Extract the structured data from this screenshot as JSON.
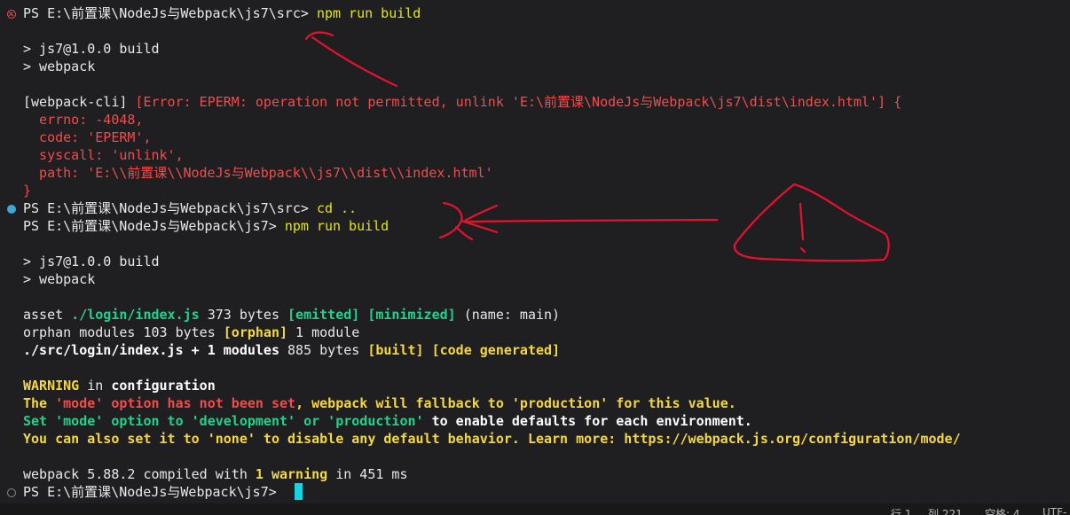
{
  "terminal": {
    "cmd1": {
      "prompt": "PS E:\\前置课\\NodeJs与Webpack\\js7\\src> ",
      "command": "npm run build"
    },
    "build1": {
      "script": "> js7@1.0.0 build",
      "webpack": "> webpack"
    },
    "error": {
      "prefix": "[webpack-cli] ",
      "message": "[Error: EPERM: operation not permitted, unlink 'E:\\前置课\\NodeJs与Webpack\\js7\\dist\\index.html'] {",
      "errno": "  errno: -4048,",
      "code": "  code: 'EPERM',",
      "syscall": "  syscall: 'unlink',",
      "path": "  path: 'E:\\\\前置课\\\\NodeJs与Webpack\\\\js7\\\\dist\\\\index.html'",
      "close": "}"
    },
    "cmd2": {
      "prompt": "PS E:\\前置课\\NodeJs与Webpack\\js7\\src> ",
      "command": "cd .."
    },
    "cmd3": {
      "prompt": "PS E:\\前置课\\NodeJs与Webpack\\js7> ",
      "command": "npm run build"
    },
    "build2": {
      "script": "> js7@1.0.0 build",
      "webpack": "> webpack"
    },
    "asset": {
      "label": "asset ",
      "file": "./login/index.js",
      "size": " 373 bytes ",
      "emitted": "[emitted]",
      "minimized": "[minimized]",
      "name": " (name: main)"
    },
    "orphan": {
      "label": "orphan modules 103 bytes ",
      "tag": "[orphan]",
      "count": " 1 module"
    },
    "src": {
      "path": "./src/login/index.js + 1 modules",
      "size": " 885 bytes ",
      "built": "[built]",
      "generated": "[code generated]"
    },
    "warning": {
      "label": "WARNING",
      "in": " in ",
      "configuration": "configuration",
      "line2_a": "The ",
      "line2_b": "'mode' option has not been set",
      "line2_c": ", webpack will fallback to 'production' for this value.",
      "line3_a": "Set ",
      "line3_b": "'mode' option to 'development' or 'production'",
      "line3_c": " to enable defaults for each environment.",
      "line4": "You can also set it to 'none' to disable any default behavior. Learn more: https://webpack.js.org/configuration/mode/"
    },
    "compiled": {
      "a": "webpack 5.88.2 compiled with ",
      "b": "1 warning",
      "c": " in 451 ms"
    },
    "cmd4": {
      "prompt": "PS E:\\前置课\\NodeJs与Webpack\\js7> "
    }
  },
  "statusbar": {
    "line": "行 1",
    "column": "列 221",
    "spaces": "空格: 4",
    "encoding": "UTF-"
  },
  "colors": {
    "background": "#1f1f22",
    "error": "#f14c4c",
    "command": "#e5e510",
    "success": "#23d18b",
    "cursor": "#16d3e0",
    "annotation": "#e8112d"
  },
  "icons": {
    "error_marker": "error-circle-icon",
    "success_marker": "success-dot-icon",
    "idle_marker": "idle-circle-icon"
  }
}
